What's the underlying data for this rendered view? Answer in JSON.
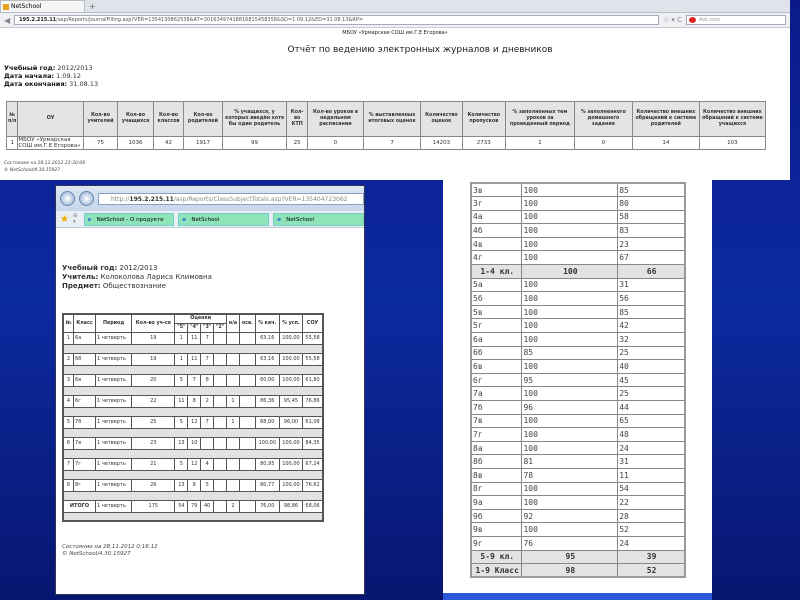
{
  "journal_window": {
    "tab": "NetSchool",
    "url_host": "195.2.215.11",
    "url_path": "/asp/Reports/JournalFilling.asp?VER=1354130862538&AT=30163497418816815458358&SD=1.09.12&ED=31.08.13&RP=",
    "search_placeholder": "Ask.com",
    "org": "МБОУ «Урмарская СОШ им.Г.Е.Егорова»",
    "title": "Отчёт по ведению электронных журналов и дневников",
    "meta": [
      {
        "k": "Учебный год:",
        "v": "2012/2013"
      },
      {
        "k": "Дата начала:",
        "v": "1.09.12"
      },
      {
        "k": "Дата окончания:",
        "v": "31.08.13"
      }
    ],
    "columns": [
      "№ п/п",
      "ОУ",
      "Кол-во учителей",
      "Кол-во учащихся",
      "Кол-во классов",
      "Кол-во родителей",
      "% учащихся, у которых введён хотя бы один родитель",
      "Кол-во КТП",
      "Кол-во уроков в недельном расписании",
      "% выставленных итоговых оценок",
      "Количество оценок",
      "Количество пропусков",
      "% заполненных тем уроков за проведенный период",
      "% заполненного домашнего задания",
      "Количество внешних обращений к системе родителей",
      "Количество внешних обращений к системе учащихся"
    ],
    "row": [
      "1",
      "МБОУ «Урмарская СОШ им.Г.Е.Егорова»",
      "75",
      "1036",
      "42",
      "1917",
      "99",
      "25",
      "0",
      "7",
      "14203",
      "2733",
      "1",
      "0",
      "14",
      "103"
    ],
    "footer_state": "Состояние на 28.11.2012 23:30:08",
    "footer_version": "© NetSchool/4.30.15927"
  },
  "class_window": {
    "url_host": "195.2.215.11",
    "url_path": "/asp/Reports/ClassSubjectTotals.asp?VER=135404723062",
    "tabs": [
      "NetSchool - О продукте",
      "NetSchool",
      "NetSchool"
    ],
    "meta": [
      {
        "k": "Учебный год:",
        "v": "2012/2013"
      },
      {
        "k": "Учитель:",
        "v": "Колоколова Лариса Климовна"
      },
      {
        "k": "Предмет:",
        "v": "Обществознание"
      }
    ],
    "headers": {
      "n": "№",
      "cls": "Класс",
      "period": "Период",
      "count": "Кол-во уч-ся",
      "grades": "Оценки",
      "g5": "\"5\"",
      "g4": "\"4\"",
      "g3": "\"3\"",
      "g2": "\"2\"",
      "na": "н/а",
      "osv": "осв.",
      "qual": "% кач.",
      "succ": "% усп.",
      "sou": "СОУ"
    },
    "rows": [
      [
        "1",
        "6а",
        "1 четверть",
        "19",
        "1",
        "11",
        "7",
        "",
        "",
        "",
        "63,16",
        "100,00",
        "55,58"
      ],
      [
        "2",
        "6б",
        "1 четверть",
        "19",
        "1",
        "11",
        "7",
        "",
        "",
        "",
        "63,16",
        "100,00",
        "55,58"
      ],
      [
        "3",
        "6в",
        "1 четверть",
        "20",
        "5",
        "7",
        "8",
        "",
        "",
        "",
        "60,00",
        "100,00",
        "61,80"
      ],
      [
        "4",
        "6г",
        "1 четверть",
        "22",
        "11",
        "8",
        "2",
        "",
        "1",
        "",
        "86,36",
        "95,45",
        "76,86"
      ],
      [
        "5",
        "7б",
        "1 четверть",
        "25",
        "5",
        "12",
        "7",
        "",
        "1",
        "",
        "68,00",
        "96,00",
        "61,08"
      ],
      [
        "6",
        "7в",
        "1 четверть",
        "23",
        "13",
        "10",
        "",
        "",
        "",
        "",
        "100,00",
        "100,00",
        "84,35"
      ],
      [
        "7",
        "7г",
        "1 четверть",
        "21",
        "5",
        "12",
        "4",
        "",
        "",
        "",
        "80,95",
        "100,00",
        "67,24"
      ],
      [
        "8",
        "8г",
        "1 четверть",
        "26",
        "13",
        "8",
        "5",
        "",
        "",
        "",
        "80,77",
        "100,00",
        "76,62"
      ]
    ],
    "total": [
      "ИТОГО",
      "1 четверть",
      "175",
      "54",
      "79",
      "40",
      "",
      "2",
      "",
      "76,00",
      "98,86",
      "68,06"
    ],
    "footer_state": "Состояние на 28.11.2012 0:16:12",
    "footer_version": "© NetSchool/4.30.15927"
  },
  "class_summary": {
    "rows": [
      [
        "3в",
        "100",
        "85"
      ],
      [
        "3г",
        "100",
        "80"
      ],
      [
        "4а",
        "100",
        "58"
      ],
      [
        "4б",
        "100",
        "83"
      ],
      [
        "4в",
        "100",
        "23"
      ],
      [
        "4г",
        "100",
        "67"
      ],
      [
        "1-4 кл.",
        "100",
        "66",
        "t"
      ],
      [
        "5а",
        "100",
        "31"
      ],
      [
        "5б",
        "100",
        "56"
      ],
      [
        "5в",
        "100",
        "85"
      ],
      [
        "5г",
        "100",
        "42"
      ],
      [
        "6а",
        "100",
        "32"
      ],
      [
        "6б",
        "85",
        "25"
      ],
      [
        "6в",
        "100",
        "40"
      ],
      [
        "6г",
        "95",
        "45"
      ],
      [
        "7а",
        "100",
        "25"
      ],
      [
        "7б",
        "96",
        "44"
      ],
      [
        "7в",
        "100",
        "65"
      ],
      [
        "7г",
        "100",
        "48"
      ],
      [
        "8а",
        "100",
        "24"
      ],
      [
        "8б",
        "81",
        "31"
      ],
      [
        "8в",
        "78",
        "11"
      ],
      [
        "8г",
        "100",
        "54"
      ],
      [
        "9а",
        "100",
        "22"
      ],
      [
        "9б",
        "92",
        "28"
      ],
      [
        "9в",
        "100",
        "52"
      ],
      [
        "9г",
        "76",
        "24"
      ],
      [
        "5-9 кл.",
        "95",
        "39",
        "t"
      ],
      [
        "1-9 Класс",
        "98",
        "52",
        "t"
      ]
    ]
  }
}
